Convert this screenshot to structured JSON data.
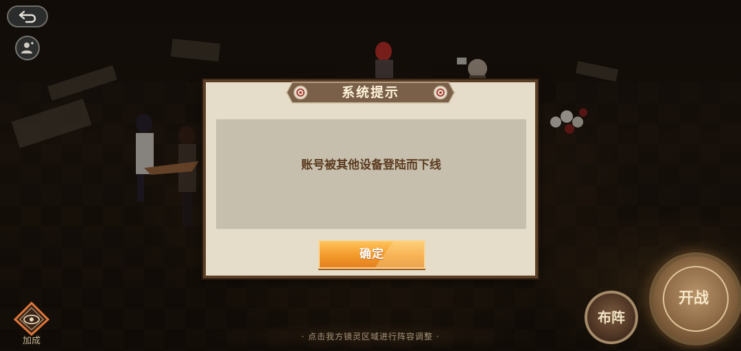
{
  "dialog": {
    "title": "系统提示",
    "message": "账号被其他设备登陆而下线",
    "confirm_label": "确定"
  },
  "hud": {
    "hint": "· 点击我方镜灵区域进行阵容调整 ·",
    "bonus_label": "加成",
    "formation_label": "布阵",
    "battle_label": "开战",
    "back_icon": "back-arrow-icon",
    "friend_icon": "person-icon"
  },
  "colors": {
    "dialog_bg": "#e5ddca",
    "dialog_border": "#5a3e25",
    "title_banner": "#7a6048",
    "confirm_button": "#f39a2a",
    "message_text": "#5a3a1e"
  }
}
